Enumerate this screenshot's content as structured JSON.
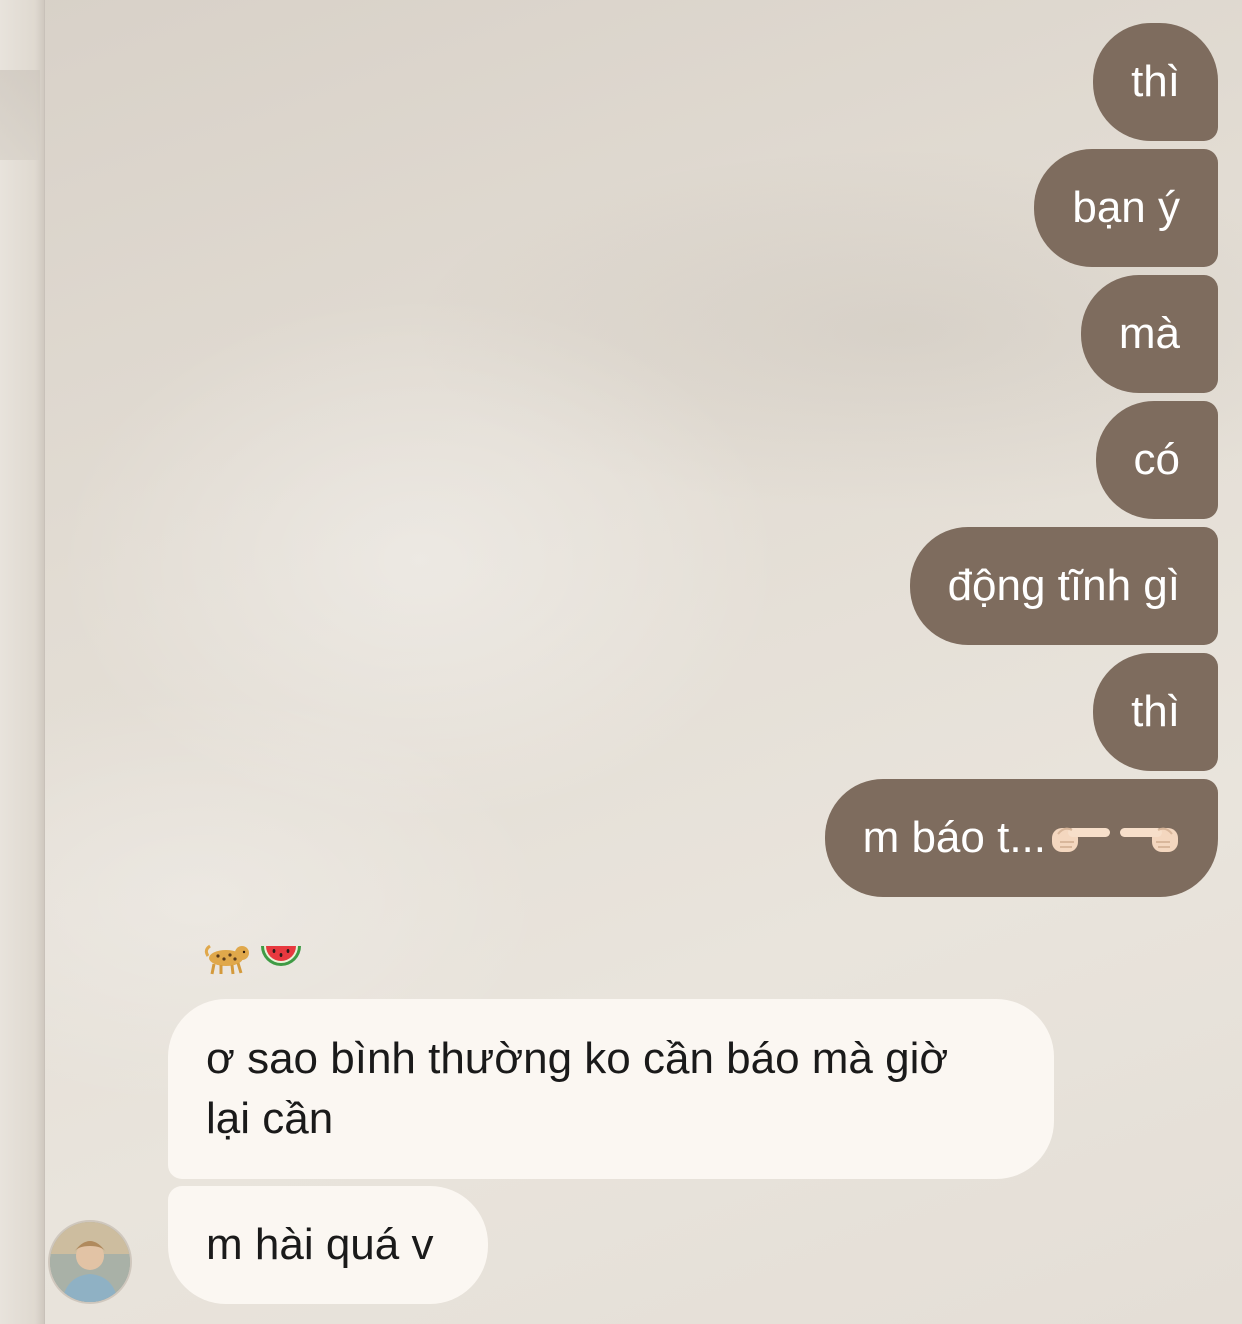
{
  "conversation": {
    "outgoing": [
      {
        "text": "thì"
      },
      {
        "text": "bạn ý"
      },
      {
        "text": "mà"
      },
      {
        "text": "có"
      },
      {
        "text": "động tĩnh gì"
      },
      {
        "text": "thì"
      },
      {
        "text": "m báo t...",
        "emoji": [
          "pointing-right-emoji",
          "pointing-left-emoji"
        ]
      }
    ],
    "reactions": [
      "leopard-emoji",
      "watermelon-emoji"
    ],
    "incoming": [
      {
        "line1": "ơ sao bình thường ko cần báo mà giờ",
        "line2": "lại cần"
      },
      {
        "text": "m hài quá v"
      }
    ]
  },
  "colors": {
    "outgoing_bubble": "#7e6c5e",
    "incoming_bubble": "#fbf7f2",
    "outgoing_text": "#ffffff",
    "incoming_text": "#1a1a1a"
  }
}
